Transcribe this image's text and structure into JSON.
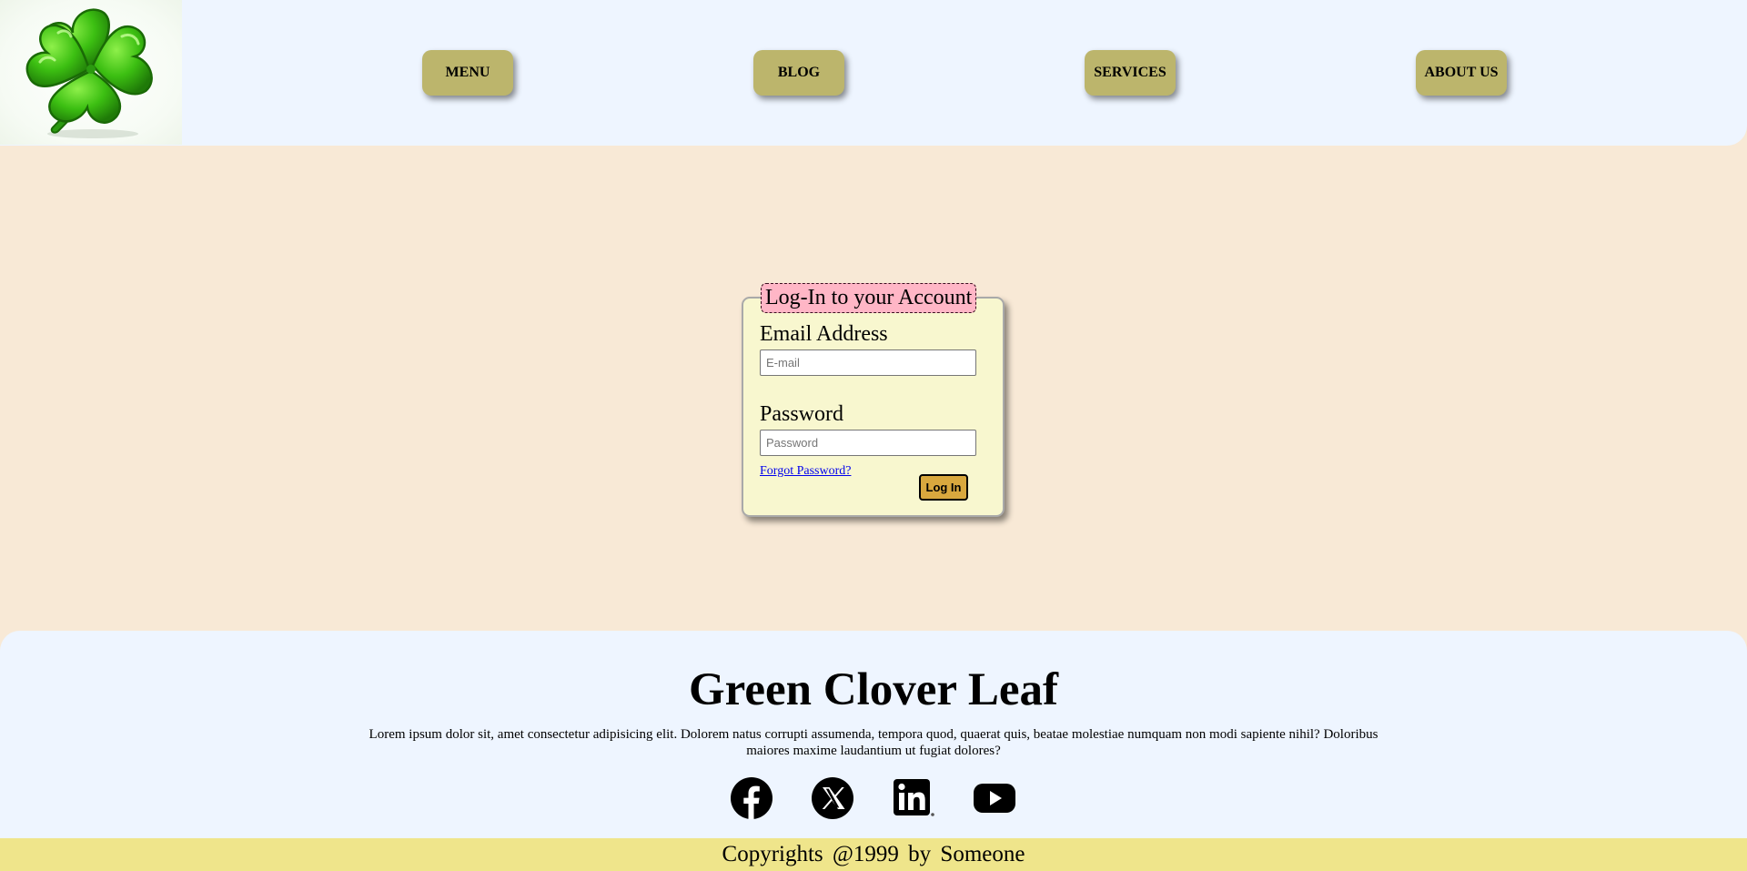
{
  "header": {
    "logo_icon": "four-leaf-clover-icon",
    "nav": [
      {
        "label": "MENU"
      },
      {
        "label": "BLOG"
      },
      {
        "label": "SERVICES"
      },
      {
        "label": "ABOUT US"
      }
    ]
  },
  "login": {
    "title": "Log-In to your Account",
    "email_label": "Email Address",
    "email_placeholder": "E-mail",
    "email_value": "",
    "password_label": "Password",
    "password_placeholder": "Password",
    "password_value": "",
    "forgot_link": "Forgot Password?",
    "submit_label": "Log In"
  },
  "footer": {
    "brand": "Green Clover Leaf",
    "description": "Lorem ipsum dolor sit, amet consectetur adipisicing elit. Dolorem natus corrupti assumenda, tempora quod, quaerat quis, beatae molestiae numquam non modi sapiente nihil? Doloribus maiores maxime laudantium ut fugiat dolores?",
    "social": [
      {
        "icon": "facebook-icon"
      },
      {
        "icon": "x-twitter-icon"
      },
      {
        "icon": "linkedin-icon"
      },
      {
        "icon": "youtube-icon"
      }
    ],
    "copyright": "Copyrights @1999 by Someone"
  },
  "colors": {
    "page_bg": "#f8e9d6",
    "header_bg": "#eef5ff",
    "nav_button": "#bcb56c",
    "card_bg": "#f8f7cf",
    "legend_bg": "#ffb6c6",
    "login_button": "#d9a83e",
    "copyright_bg": "#efe58b"
  }
}
